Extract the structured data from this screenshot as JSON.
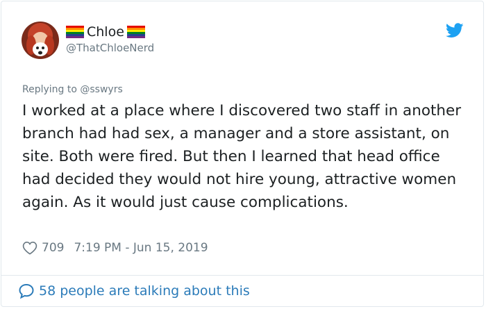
{
  "tweet": {
    "display_name": "Chloe",
    "handle": "@ThatChloeNerd",
    "reply_context": "Replying to @sswyrs",
    "text": "I worked at a place where I discovered two staff in another branch had had sex, a manager and a store assistant, on site. Both were fired. But then I learned that head office had decided they would not hire young, attractive women again. As it would just cause complications.",
    "like_count": "709",
    "timestamp": "7:19 PM - Jun 15, 2019"
  },
  "footer": {
    "conversation": "58 people are talking about this"
  },
  "icons": {
    "logo": "twitter-bird-icon",
    "flag": "rainbow-flag-icon",
    "like": "heart-icon",
    "reply": "speech-bubble-icon"
  },
  "colors": {
    "twitter_blue": "#1da1f2",
    "link_blue": "#2b7bb9",
    "secondary_text": "#697882",
    "primary_text": "#1c2022",
    "border": "#e1e8ed"
  }
}
